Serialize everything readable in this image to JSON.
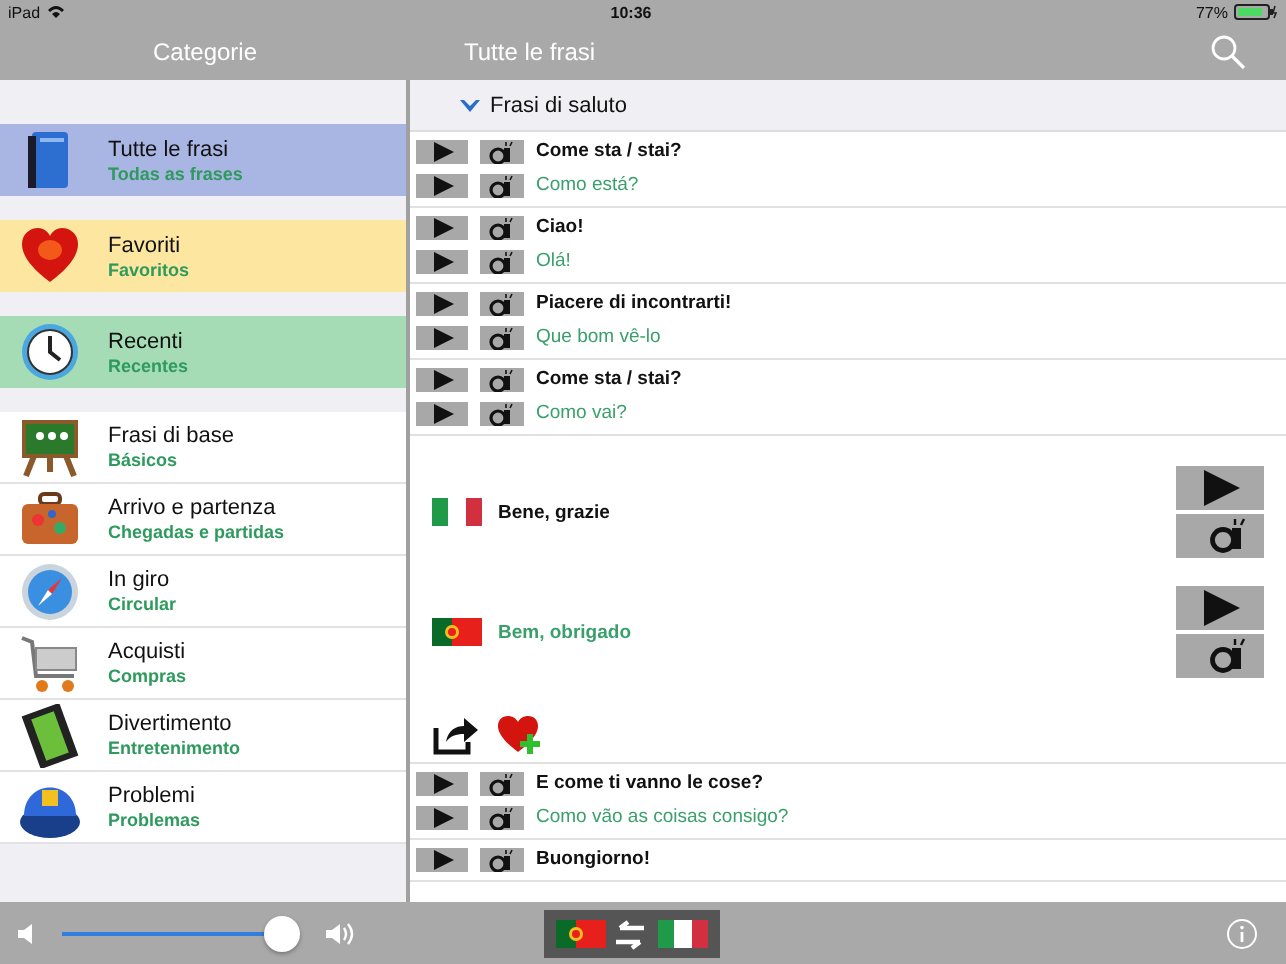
{
  "status_bar": {
    "device": "iPad",
    "time": "10:36",
    "battery": "77%"
  },
  "nav": {
    "left_title": "Categorie",
    "right_title": "Tutte le frasi"
  },
  "sidebar": {
    "highlighted": [
      {
        "title": "Tutte le frasi",
        "subtitle": "Todas as frases",
        "color": "#a9b5e2"
      },
      {
        "title": "Favoriti",
        "subtitle": "Favoritos",
        "color": "#fde6a0"
      },
      {
        "title": "Recenti",
        "subtitle": "Recentes",
        "color": "#a5dcb6"
      }
    ],
    "categories": [
      {
        "title": "Frasi di base",
        "subtitle": "Básicos"
      },
      {
        "title": "Arrivo e partenza",
        "subtitle": "Chegadas e partidas"
      },
      {
        "title": "In giro",
        "subtitle": "Circular"
      },
      {
        "title": "Acquisti",
        "subtitle": "Compras"
      },
      {
        "title": "Divertimento",
        "subtitle": "Entretenimento"
      },
      {
        "title": "Problemi",
        "subtitle": "Problemas"
      }
    ]
  },
  "section": {
    "title": "Frasi di saluto",
    "expanded": true
  },
  "phrases": [
    {
      "kind": "pair",
      "italian": "Come sta / stai?",
      "portuguese": "Como está?"
    },
    {
      "kind": "pair",
      "italian": "Ciao!",
      "portuguese": "Olá!"
    },
    {
      "kind": "pair",
      "italian": "Piacere di incontrarti!",
      "portuguese": "Que bom vê-lo"
    },
    {
      "kind": "pair",
      "italian": "Come sta / stai?",
      "portuguese": "Como vai?"
    },
    {
      "kind": "expanded",
      "italian": "Bene, grazie",
      "portuguese": "Bem, obrigado"
    },
    {
      "kind": "pair",
      "italian": "E come ti vanno le cose?",
      "portuguese": "Como vão as coisas consigo?"
    },
    {
      "kind": "single",
      "italian": "Buongiorno!"
    }
  ],
  "toolbar": {
    "volume": {
      "level": 0.93
    }
  }
}
